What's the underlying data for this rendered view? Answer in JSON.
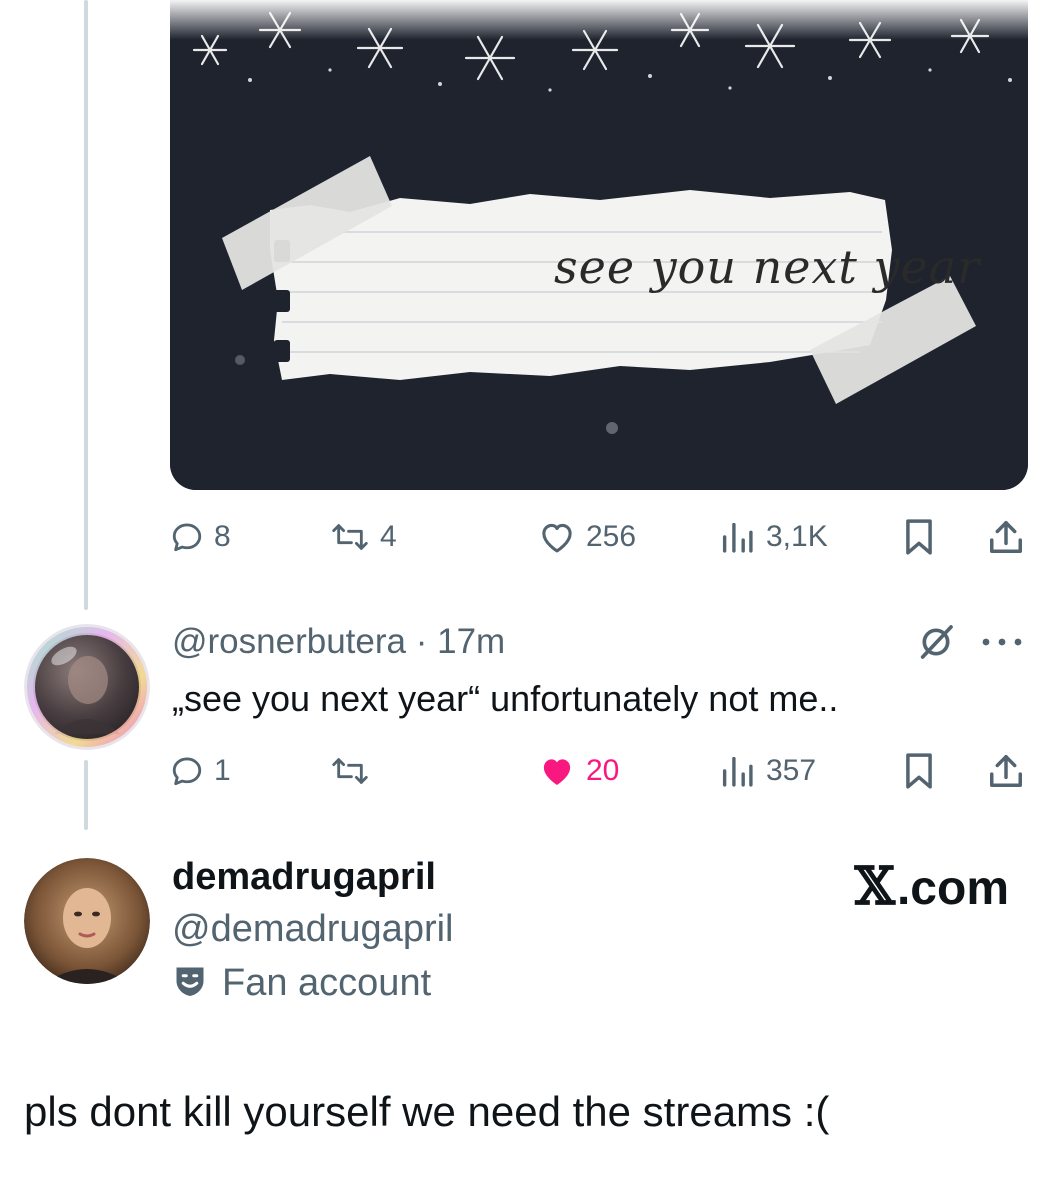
{
  "media": {
    "note_text": "see you next year"
  },
  "tweet_actions": {
    "replies": "8",
    "reposts": "4",
    "likes": "256",
    "views": "3,1K"
  },
  "reply": {
    "handle": "@rosnerbutera",
    "separator": "·",
    "time": "17m",
    "text": "„see you next year“ unfortunately not me..",
    "actions": {
      "replies": "1",
      "reposts": "",
      "likes": "20",
      "views": "357"
    }
  },
  "profile": {
    "display_name": "demadrugapril",
    "handle": "@demadrugapril",
    "label": "Fan account"
  },
  "brand": {
    "x_glyph": "𝕏",
    "domain": ".com"
  },
  "post": {
    "text": "pls dont kill yourself we need the streams :("
  },
  "colors": {
    "like_pink": "#f91880",
    "muted": "#536471",
    "thread_line": "#cfd9de",
    "media_bg": "#1e232e"
  },
  "icons": [
    "reply-icon",
    "repost-icon",
    "heart-icon",
    "views-icon",
    "bookmark-icon",
    "share-icon",
    "grok-icon",
    "more-icon",
    "fan-account-icon"
  ]
}
